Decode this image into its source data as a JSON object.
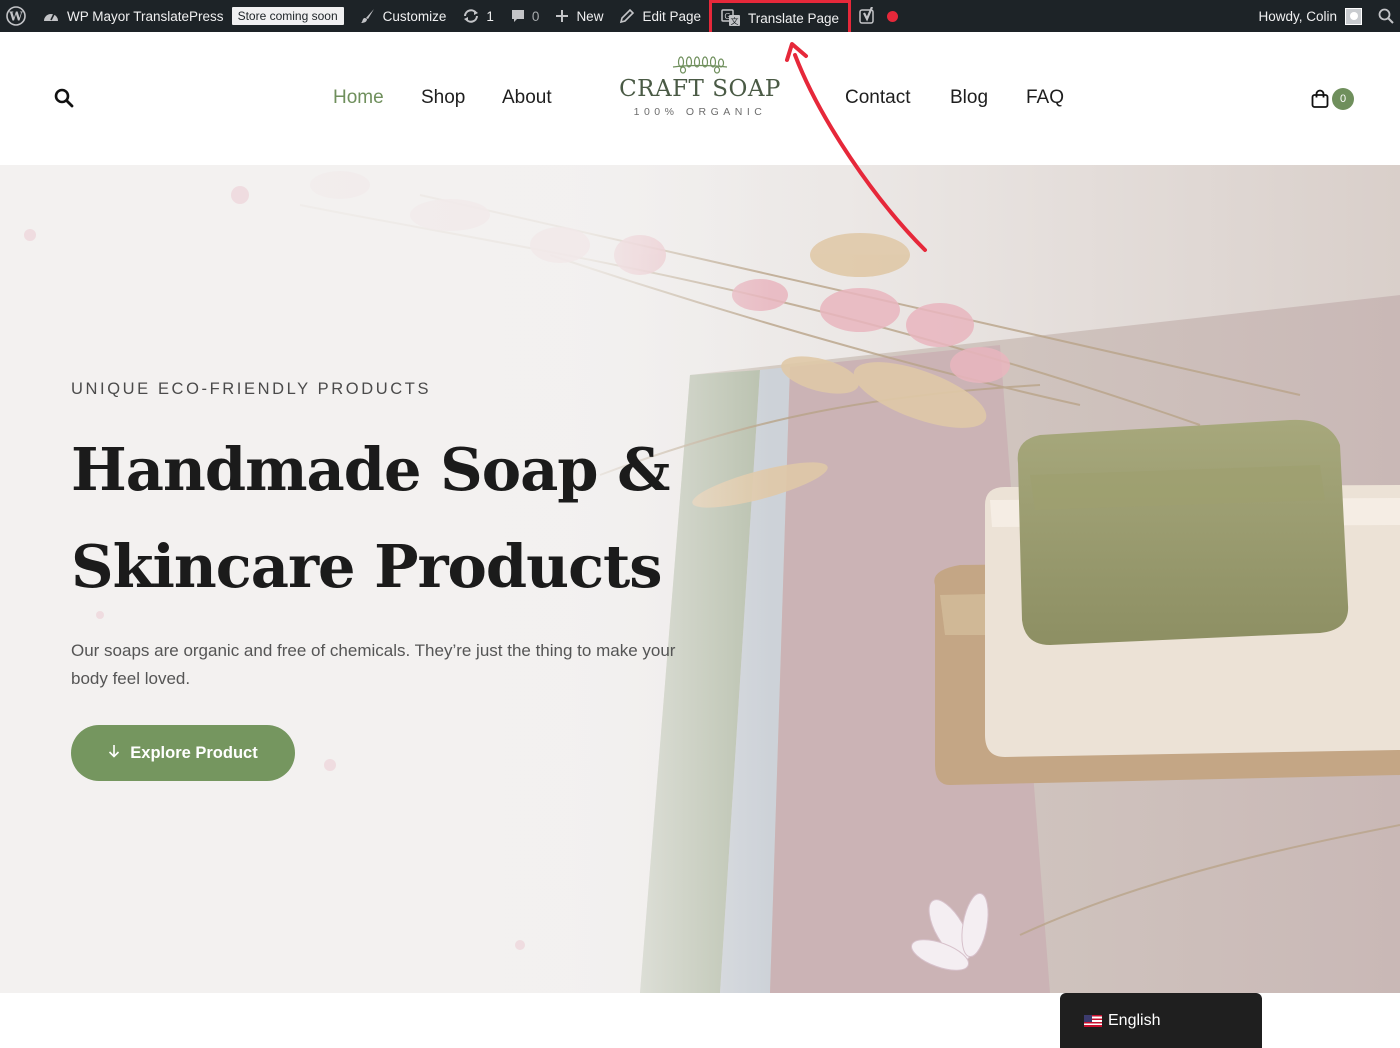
{
  "admin_bar": {
    "site_name": "WP Mayor TranslatePress",
    "store_badge": "Store coming soon",
    "customize": "Customize",
    "updates_count": "1",
    "comments_count": "0",
    "new_label": "New",
    "edit_page": "Edit Page",
    "translate_page": "Translate Page",
    "howdy": "Howdy, Colin"
  },
  "header": {
    "nav_left": [
      "Home",
      "Shop",
      "About"
    ],
    "nav_right": [
      "Contact",
      "Blog",
      "FAQ"
    ],
    "active_item": "Home",
    "logo_name": "CRAFT SOAP",
    "logo_tagline": "100% ORGANIC",
    "cart_count": "0"
  },
  "hero": {
    "kicker": "UNIQUE ECO-FRIENDLY PRODUCTS",
    "title_line1": "Handmade Soap &",
    "title_line2": "Skincare Products",
    "text": "Our soaps are organic and free of chemicals. They’re just the thing to make your body feel loved.",
    "button_label": "Explore Product",
    "button_icon": "arrow-down-icon"
  },
  "language_switcher": {
    "current": "English",
    "flag": "us-flag-icon"
  },
  "colors": {
    "admin_bar_bg": "#1d2327",
    "accent_green": "#75965f",
    "highlight_red": "#e6283a"
  }
}
